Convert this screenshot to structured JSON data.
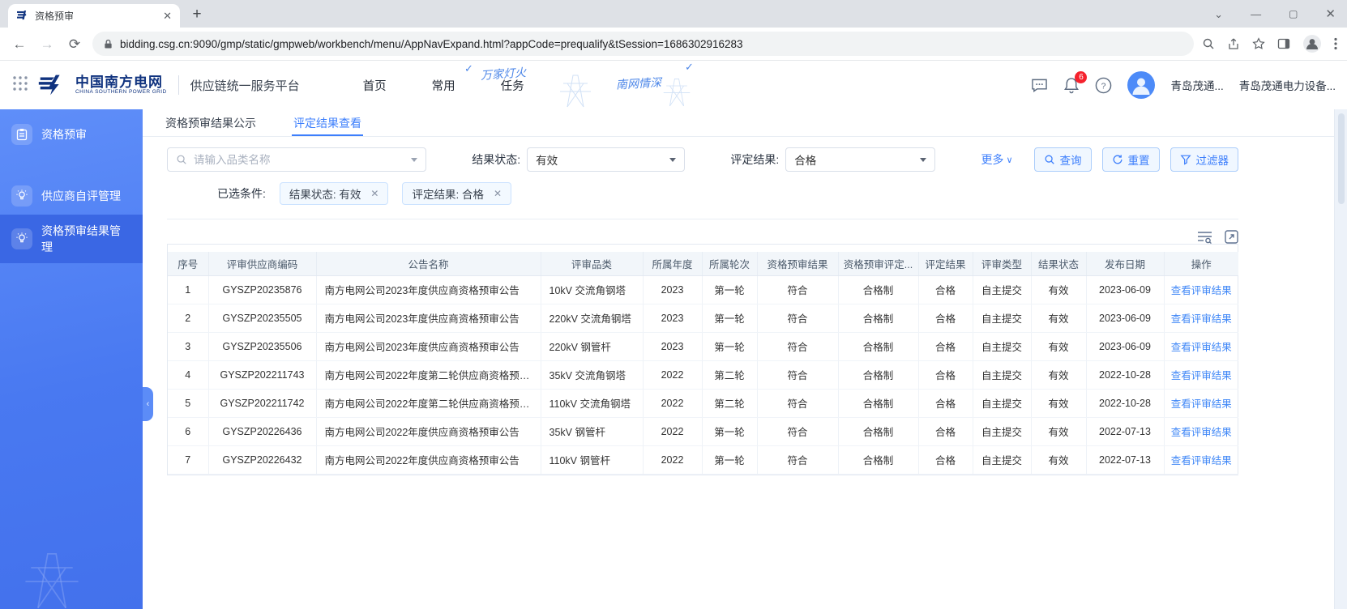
{
  "browser": {
    "tab_title": "资格预审",
    "url": "bidding.csg.cn:9090/gmp/static/gmpweb/workbench/menu/AppNavExpand.html?appCode=prequalify&tSession=1686302916283"
  },
  "header": {
    "brand": "中国南方电网",
    "brand_sub": "CHINA SOUTHERN POWER GRID",
    "platform": "供应链统一服务平台",
    "nav": [
      {
        "label": "首页"
      },
      {
        "label": "常用"
      },
      {
        "label": "任务"
      }
    ],
    "slogan_part1": "万家灯火",
    "slogan_part2": "南网情深",
    "notification_count": "6",
    "user_short": "青岛茂通...",
    "company": "青岛茂通电力设备..."
  },
  "sidebar": {
    "items": [
      {
        "label": "资格预审",
        "icon": "clipboard",
        "active": false
      },
      {
        "label": "供应商自评管理",
        "icon": "bulb",
        "active": false
      },
      {
        "label": "资格预审结果管理",
        "icon": "bulb",
        "active": true
      }
    ]
  },
  "tabs": [
    {
      "label": "资格预审结果公示",
      "active": false
    },
    {
      "label": "评定结果查看",
      "active": true
    }
  ],
  "filters": {
    "search_placeholder": "请输入品类名称",
    "result_status_label": "结果状态:",
    "result_status_value": "有效",
    "evaluation_label": "评定结果:",
    "evaluation_value": "合格",
    "more_label": "更多",
    "query_label": "查询",
    "reset_label": "重置",
    "filter_label": "过滤器",
    "selected_label": "已选条件:",
    "chips": [
      {
        "text": "结果状态: 有效"
      },
      {
        "text": "评定结果: 合格"
      }
    ]
  },
  "table": {
    "columns": [
      "序号",
      "评审供应商编码",
      "公告名称",
      "评审品类",
      "所属年度",
      "所属轮次",
      "资格预审结果",
      "资格预审评定...",
      "评定结果",
      "评审类型",
      "结果状态",
      "发布日期",
      "操作"
    ],
    "action_label": "查看评审结果",
    "rows": [
      [
        "1",
        "GYSZP20235876",
        "南方电网公司2023年度供应商资格预审公告",
        "10kV 交流角钢塔",
        "2023",
        "第一轮",
        "符合",
        "合格制",
        "合格",
        "自主提交",
        "有效",
        "2023-06-09"
      ],
      [
        "2",
        "GYSZP20235505",
        "南方电网公司2023年度供应商资格预审公告",
        "220kV 交流角钢塔",
        "2023",
        "第一轮",
        "符合",
        "合格制",
        "合格",
        "自主提交",
        "有效",
        "2023-06-09"
      ],
      [
        "3",
        "GYSZP20235506",
        "南方电网公司2023年度供应商资格预审公告",
        "220kV 钢管杆",
        "2023",
        "第一轮",
        "符合",
        "合格制",
        "合格",
        "自主提交",
        "有效",
        "2023-06-09"
      ],
      [
        "4",
        "GYSZP202211743",
        "南方电网公司2022年度第二轮供应商资格预审公...",
        "35kV 交流角钢塔",
        "2022",
        "第二轮",
        "符合",
        "合格制",
        "合格",
        "自主提交",
        "有效",
        "2022-10-28"
      ],
      [
        "5",
        "GYSZP202211742",
        "南方电网公司2022年度第二轮供应商资格预审公...",
        "110kV 交流角钢塔",
        "2022",
        "第二轮",
        "符合",
        "合格制",
        "合格",
        "自主提交",
        "有效",
        "2022-10-28"
      ],
      [
        "6",
        "GYSZP20226436",
        "南方电网公司2022年度供应商资格预审公告",
        "35kV 钢管杆",
        "2022",
        "第一轮",
        "符合",
        "合格制",
        "合格",
        "自主提交",
        "有效",
        "2022-07-13"
      ],
      [
        "7",
        "GYSZP20226432",
        "南方电网公司2022年度供应商资格预审公告",
        "110kV 钢管杆",
        "2022",
        "第一轮",
        "符合",
        "合格制",
        "合格",
        "自主提交",
        "有效",
        "2022-07-13"
      ]
    ]
  },
  "colors": {
    "accent_blue": "#3D7FFC",
    "sidebar_blue": "#4979F1",
    "badge_red": "#F5222D",
    "link_blue": "#4188F7"
  }
}
